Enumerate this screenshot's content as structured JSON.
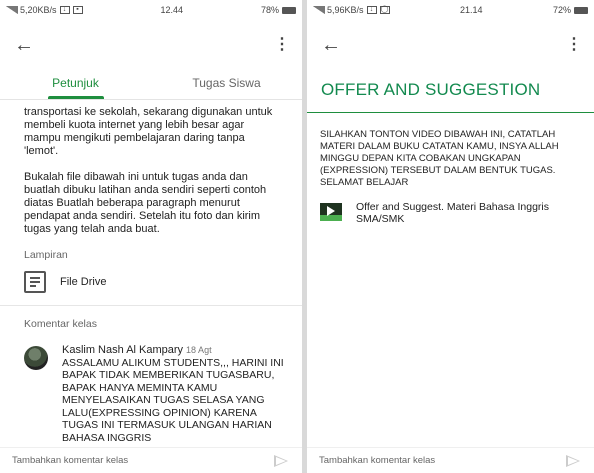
{
  "left": {
    "status": {
      "left": "5,20KB/s",
      "time": "12.44",
      "battery": "78%"
    },
    "tabs": [
      "Petunjuk",
      "Tugas Siswa"
    ],
    "body": [
      "transportasi ke sekolah, sekarang digunakan untuk membeli kuota internet yang lebih besar agar mampu mengikuti pembelajaran daring tanpa 'lemot'.",
      "Bukalah file dibawah ini untuk tugas anda dan buatlah dibuku latihan anda sendiri seperti contoh diatas  Buatlah beberapa paragraph menurut pendapat anda sendiri. Setelah itu foto dan kirim tugas yang telah anda buat."
    ],
    "attachments_label": "Lampiran",
    "attachment": "File Drive",
    "comments_label": "Komentar kelas",
    "comment": {
      "author": "Kaslim Nash Al Kampary",
      "date": "18 Agt",
      "text": "ASSALAMU ALIKUM STUDENTS,,, HARINI INI BAPAK TIDAK MEMBERIKAN TUGASBARU, BAPAK HANYA MEMINTA KAMU MENYELASAIKAN TUGAS SELASA YANG LALU(EXPRESSING OPINION) KARENA TUGAS INI TERMASUK ULANGAN HARIAN BAHASA INGGRIS"
    },
    "composer_placeholder": "Tambahkan komentar kelas"
  },
  "right": {
    "status": {
      "left": "5,96KB/s",
      "time": "21.14",
      "battery": "72%"
    },
    "title": "OFFER AND SUGGESTION",
    "description": "SILAHKAN TONTON VIDEO DIBAWAH INI, CATATLAH MATERI DALAM BUKU CATATAN KAMU, INSYA ALLAH MINGGU DEPAN KITA COBAKAN UNGKAPAN (EXPRESSION) TERSEBUT DALAM BENTUK TUGAS. SELAMAT BELAJAR",
    "material": "Offer and Suggest. Materi Bahasa Inggris SMA/SMK",
    "composer_placeholder": "Tambahkan komentar kelas"
  },
  "colors": {
    "accent": "#1e8e3e",
    "title": "#138a4f"
  },
  "icons": [
    "back-arrow-icon",
    "more-vert-icon",
    "document-icon",
    "avatar",
    "youtube-video-icon",
    "send-icon"
  ]
}
